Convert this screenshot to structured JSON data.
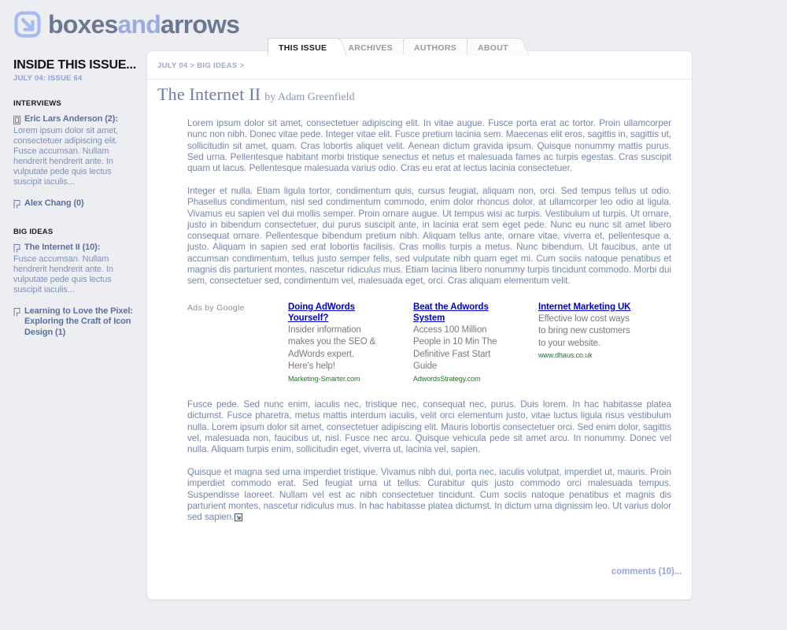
{
  "site": {
    "logo_icon": "boxed-arrow-logo-icon",
    "logo_part1": "boxes",
    "logo_part2": "and",
    "logo_part3": "arrows",
    "brand_blue": "#9aabe0",
    "brand_slate": "#6e7695"
  },
  "tabs": [
    {
      "label": "THIS ISSUE",
      "active": true
    },
    {
      "label": "ARCHIVES",
      "active": false
    },
    {
      "label": "AUTHORS",
      "active": false
    },
    {
      "label": "ABOUT",
      "active": false
    }
  ],
  "sidebar": {
    "title": "INSIDE THIS ISSUE...",
    "subtitle": "JULY 04: ISSUE 64",
    "sections": [
      {
        "name": "INTERVIEWS",
        "entries": [
          {
            "icon": "document-icon",
            "link": "Eric Lars Anderson (2):",
            "desc": "Lorem ipsum dolor sit amet, consectetuer adipiscing elit. Fusce accumsan. Nullam hendrerit hendrerit ante. In vulputate pede quis lectus suscipit iaculis..."
          },
          {
            "icon": "flag-icon",
            "link": "Alex Chang (0)",
            "desc": ""
          }
        ]
      },
      {
        "name": "BIG IDEAS",
        "entries": [
          {
            "icon": "flag-icon",
            "link": "The Internet II (10):",
            "desc": "Fusce accumsan. Nullam hendrerit hendrerit ante. In vulputate pede quis lectus suscipit iaculis..."
          },
          {
            "icon": "flag-icon",
            "link": "Learning to Love the Pixel: Exploring the Craft of Icon Design (1)",
            "desc": ""
          }
        ]
      }
    ]
  },
  "article": {
    "breadcrumb": "JULY 04 > BIG IDEAS >",
    "title": "The Internet II",
    "byline": "by Adam Greenfield",
    "paragraphs": [
      "Lorem ipsum dolor sit amet, consectetuer adipiscing elit. In vitae augue. Fusce porta erat ac tortor. Proin ullamcorper nunc non nibh. Donec vitae pede. Integer vitae elit. Fusce pretium lacinia sem. Maecenas elit eros, sagittis in, sagittis ut, sollicitudin sit amet, quam. Cras lobortis aliquet velit. Aenean dictum gravida ipsum. Quisque nonummy mattis purus. Sed urna. Pellentesque habitant morbi tristique senectus et netus et malesuada fames ac turpis egestas. Cras suscipit quam ut lacus. Pellentesque malesuada varius odio. Cras eu erat at lectus lacinia consectetuer.",
      "Integer et nulla. Etiam ligula tortor, condimentum quis, cursus feugiat, aliquam non, orci. Sed tempus tellus ut odio. Phasellus condimentum, nisl sed condimentum commodo, enim dolor rhoncus dolor, at ullamcorper leo odio at ligula. Vivamus eu sapien vel dui mollis semper. Proin ornare augue. Ut tempus wisi ac turpis. Vestibulum ut turpis. Ut ornare, justo in bibendum consectetuer, dui purus suscipit ante, in lacinia erat sem eget pede. Nunc eu nunc sit amet libero consequat ornare. Pellentesque bibendum pretium nibh. Aliquam tellus ante, ornare vitae, viverra et, pellentesque a, justo. Aliquam in sapien sed erat lobortis facilisis. Cras mollis turpis a metus. Nunc bibendum. Ut faucibus, ante ut accumsan condimentum, tellus justo semper felis, sed vulputate nibh quam eget mi. Cum sociis natoque penatibus et magnis dis parturient montes, nascetur ridiculus mus. Etiam lacinia libero nonummy turpis tincidunt commodo. Morbi dui sem, consectetuer sed, condimentum vel, malesuada eget, orci. Cras aliquam elementum velit."
    ],
    "paragraphs_after_ads": [
      "Fusce pede. Sed nunc enim, iaculis nec, tristique nec, consequat nec, purus. Duis lorem. In hac habitasse platea dictumst. Fusce pharetra, metus mattis interdum iaculis, velit orci elementum justo, vitae luctus ligula risus vestibulum nulla. Lorem ipsum dolor sit amet, consectetuer adipiscing elit. Mauris lobortis consectetuer orci. Sed enim dolor, sagittis vel, malesuada non, faucibus ut, nisl. Fusce nec arcu. Quisque vehicula pede sit amet arcu. In nonummy. Donec vel nulla. Aliquam turpis enim, sollicitudin eget, viverra ut, lacinia vel, sapien.",
      "Quisque et magna sed urna imperdiet tristique. Vivamus nibh dui, porta nec, iaculis volutpat, imperdiet ut, mauris. Proin imperdiet commodo erat. Sed feugiat urna ut tellus. Curabitur quis justo commodo orci malesuada tempus. Suspendisse laoreet. Nullam vel est ac nibh consectetuer tincidunt. Cum sociis natoque penatibus et magnis dis parturient montes, nascetur ridiculus mus. In hac habitasse platea dictumst. In dictum urna dignissim leo. Ut varius dolor sed sapien."
    ],
    "endmark_icon": "boxed-arrow-endmark-icon",
    "comments_link": "comments (10)..."
  },
  "ads": {
    "label": "Ads by Google",
    "items": [
      {
        "title": "Doing AdWords Yourself?",
        "desc": "Insider information makes you the SEO & AdWords expert. Here's help!",
        "url": "Marketing-Smarter.com"
      },
      {
        "title": "Beat the Adwords System",
        "desc": "Access 100 Million People in 10 Min The Definitive Fast Start Guide",
        "url": "AdwordsStrategy.com"
      },
      {
        "title": "Internet Marketing UK",
        "desc": "Effective low cost ways to bring new customers to your website.",
        "url": "www.dhaus.co.uk"
      }
    ]
  }
}
